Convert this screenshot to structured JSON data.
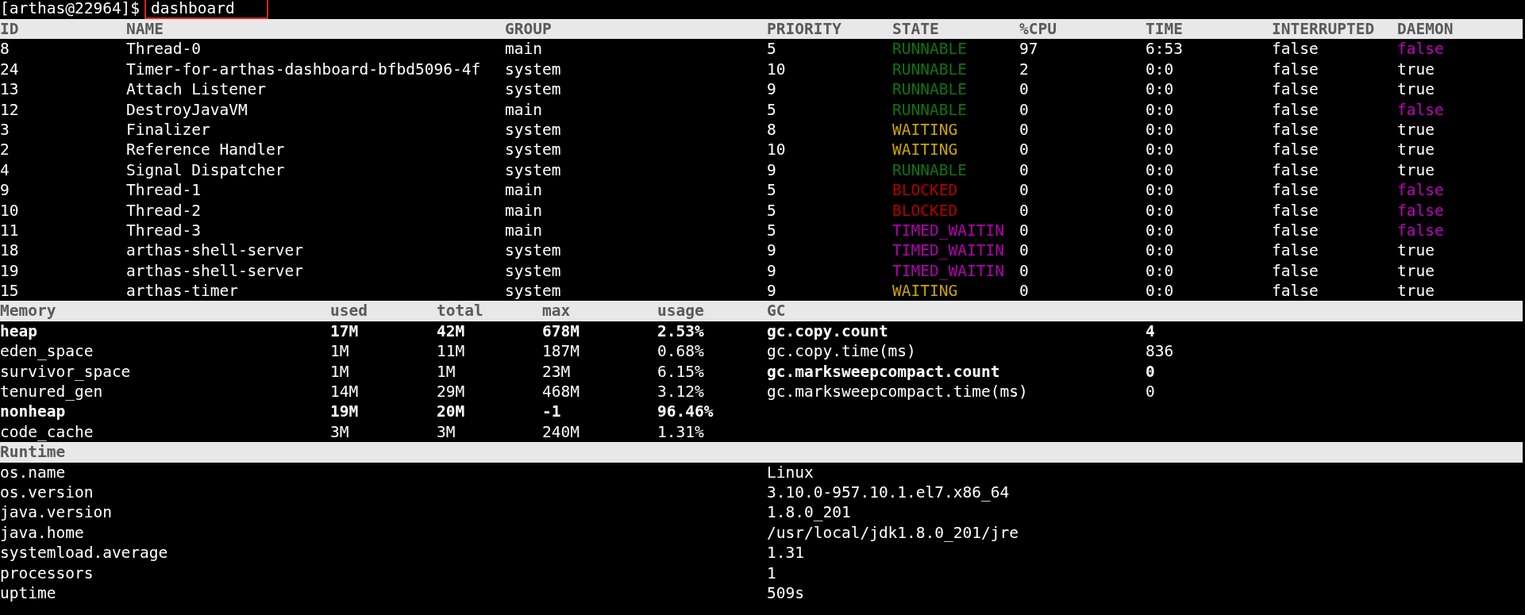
{
  "prompt": {
    "text": "[arthas@22964]$",
    "command": "dashboard"
  },
  "threads": {
    "columns": [
      "ID",
      "NAME",
      "GROUP",
      "PRIORITY",
      "STATE",
      "%CPU",
      "TIME",
      "INTERRUPTED",
      "DAEMON"
    ],
    "rows": [
      {
        "id": "8",
        "name": "Thread-0",
        "group": "main",
        "priority": "5",
        "state": {
          "text": "RUNNABLE",
          "color": "#0e740e"
        },
        "cpu": "97",
        "time": "6:53",
        "interrupted": "false",
        "daemon": {
          "text": "false",
          "color": "#c000c0"
        }
      },
      {
        "id": "24",
        "name": "Timer-for-arthas-dashboard-bfbd5096-4f",
        "group": "system",
        "priority": "10",
        "state": {
          "text": "RUNNABLE",
          "color": "#0e740e"
        },
        "cpu": "2",
        "time": "0:0",
        "interrupted": "false",
        "daemon": {
          "text": "true",
          "color": "#ffffff"
        }
      },
      {
        "id": "13",
        "name": "Attach Listener",
        "group": "system",
        "priority": "9",
        "state": {
          "text": "RUNNABLE",
          "color": "#0e740e"
        },
        "cpu": "0",
        "time": "0:0",
        "interrupted": "false",
        "daemon": {
          "text": "true",
          "color": "#ffffff"
        }
      },
      {
        "id": "12",
        "name": "DestroyJavaVM",
        "group": "main",
        "priority": "5",
        "state": {
          "text": "RUNNABLE",
          "color": "#0e740e"
        },
        "cpu": "0",
        "time": "0:0",
        "interrupted": "false",
        "daemon": {
          "text": "false",
          "color": "#c000c0"
        }
      },
      {
        "id": "3",
        "name": "Finalizer",
        "group": "system",
        "priority": "8",
        "state": {
          "text": "WAITING",
          "color": "#c8a400"
        },
        "cpu": "0",
        "time": "0:0",
        "interrupted": "false",
        "daemon": {
          "text": "true",
          "color": "#ffffff"
        }
      },
      {
        "id": "2",
        "name": "Reference Handler",
        "group": "system",
        "priority": "10",
        "state": {
          "text": "WAITING",
          "color": "#c8a400"
        },
        "cpu": "0",
        "time": "0:0",
        "interrupted": "false",
        "daemon": {
          "text": "true",
          "color": "#ffffff"
        }
      },
      {
        "id": "4",
        "name": "Signal Dispatcher",
        "group": "system",
        "priority": "9",
        "state": {
          "text": "RUNNABLE",
          "color": "#0e740e"
        },
        "cpu": "0",
        "time": "0:0",
        "interrupted": "false",
        "daemon": {
          "text": "true",
          "color": "#ffffff"
        }
      },
      {
        "id": "9",
        "name": "Thread-1",
        "group": "main",
        "priority": "5",
        "state": {
          "text": "BLOCKED",
          "color": "#b40000"
        },
        "cpu": "0",
        "time": "0:0",
        "interrupted": "false",
        "daemon": {
          "text": "false",
          "color": "#c000c0"
        }
      },
      {
        "id": "10",
        "name": "Thread-2",
        "group": "main",
        "priority": "5",
        "state": {
          "text": "BLOCKED",
          "color": "#b40000"
        },
        "cpu": "0",
        "time": "0:0",
        "interrupted": "false",
        "daemon": {
          "text": "false",
          "color": "#c000c0"
        }
      },
      {
        "id": "11",
        "name": "Thread-3",
        "group": "main",
        "priority": "5",
        "state": {
          "text": "TIMED_WAITIN",
          "color": "#b400b4"
        },
        "cpu": "0",
        "time": "0:0",
        "interrupted": "false",
        "daemon": {
          "text": "false",
          "color": "#c000c0"
        }
      },
      {
        "id": "18",
        "name": "arthas-shell-server",
        "group": "system",
        "priority": "9",
        "state": {
          "text": "TIMED_WAITIN",
          "color": "#b400b4"
        },
        "cpu": "0",
        "time": "0:0",
        "interrupted": "false",
        "daemon": {
          "text": "true",
          "color": "#ffffff"
        }
      },
      {
        "id": "19",
        "name": "arthas-shell-server",
        "group": "system",
        "priority": "9",
        "state": {
          "text": "TIMED_WAITIN",
          "color": "#b400b4"
        },
        "cpu": "0",
        "time": "0:0",
        "interrupted": "false",
        "daemon": {
          "text": "true",
          "color": "#ffffff"
        }
      },
      {
        "id": "15",
        "name": "arthas-timer",
        "group": "system",
        "priority": "9",
        "state": {
          "text": "WAITING",
          "color": "#c8a400"
        },
        "cpu": "0",
        "time": "0:0",
        "interrupted": "false",
        "daemon": {
          "text": "true",
          "color": "#ffffff"
        }
      }
    ]
  },
  "memory": {
    "columns": [
      "Memory",
      "used",
      "total",
      "max",
      "usage",
      "GC"
    ],
    "rows": [
      {
        "name": "heap",
        "used": "17M",
        "total": "42M",
        "max": "678M",
        "usage": "2.53%",
        "bold": true
      },
      {
        "name": "eden_space",
        "used": "1M",
        "total": "11M",
        "max": "187M",
        "usage": "0.68%",
        "bold": false
      },
      {
        "name": "survivor_space",
        "used": "1M",
        "total": "1M",
        "max": "23M",
        "usage": "6.15%",
        "bold": false
      },
      {
        "name": "tenured_gen",
        "used": "14M",
        "total": "29M",
        "max": "468M",
        "usage": "3.12%",
        "bold": false
      },
      {
        "name": "nonheap",
        "used": "19M",
        "total": "20M",
        "max": "-1",
        "usage": "96.46%",
        "bold": true
      },
      {
        "name": "code_cache",
        "used": "3M",
        "total": "3M",
        "max": "240M",
        "usage": "1.31%",
        "bold": false
      }
    ],
    "gc": [
      {
        "name": "gc.copy.count",
        "value": "4",
        "bold": true
      },
      {
        "name": "gc.copy.time(ms)",
        "value": "836",
        "bold": false
      },
      {
        "name": "gc.marksweepcompact.count",
        "value": "0",
        "bold": true
      },
      {
        "name": "gc.marksweepcompact.time(ms)",
        "value": "0",
        "bold": false
      }
    ]
  },
  "runtime": {
    "title": "Runtime",
    "rows": [
      {
        "name": "os.name",
        "value": "Linux"
      },
      {
        "name": "os.version",
        "value": "3.10.0-957.10.1.el7.x86_64"
      },
      {
        "name": "java.version",
        "value": "1.8.0_201"
      },
      {
        "name": "java.home",
        "value": "/usr/local/jdk1.8.0_201/jre"
      },
      {
        "name": "systemload.average",
        "value": "1.31"
      },
      {
        "name": "processors",
        "value": "1"
      },
      {
        "name": "uptime",
        "value": "509s"
      }
    ]
  }
}
